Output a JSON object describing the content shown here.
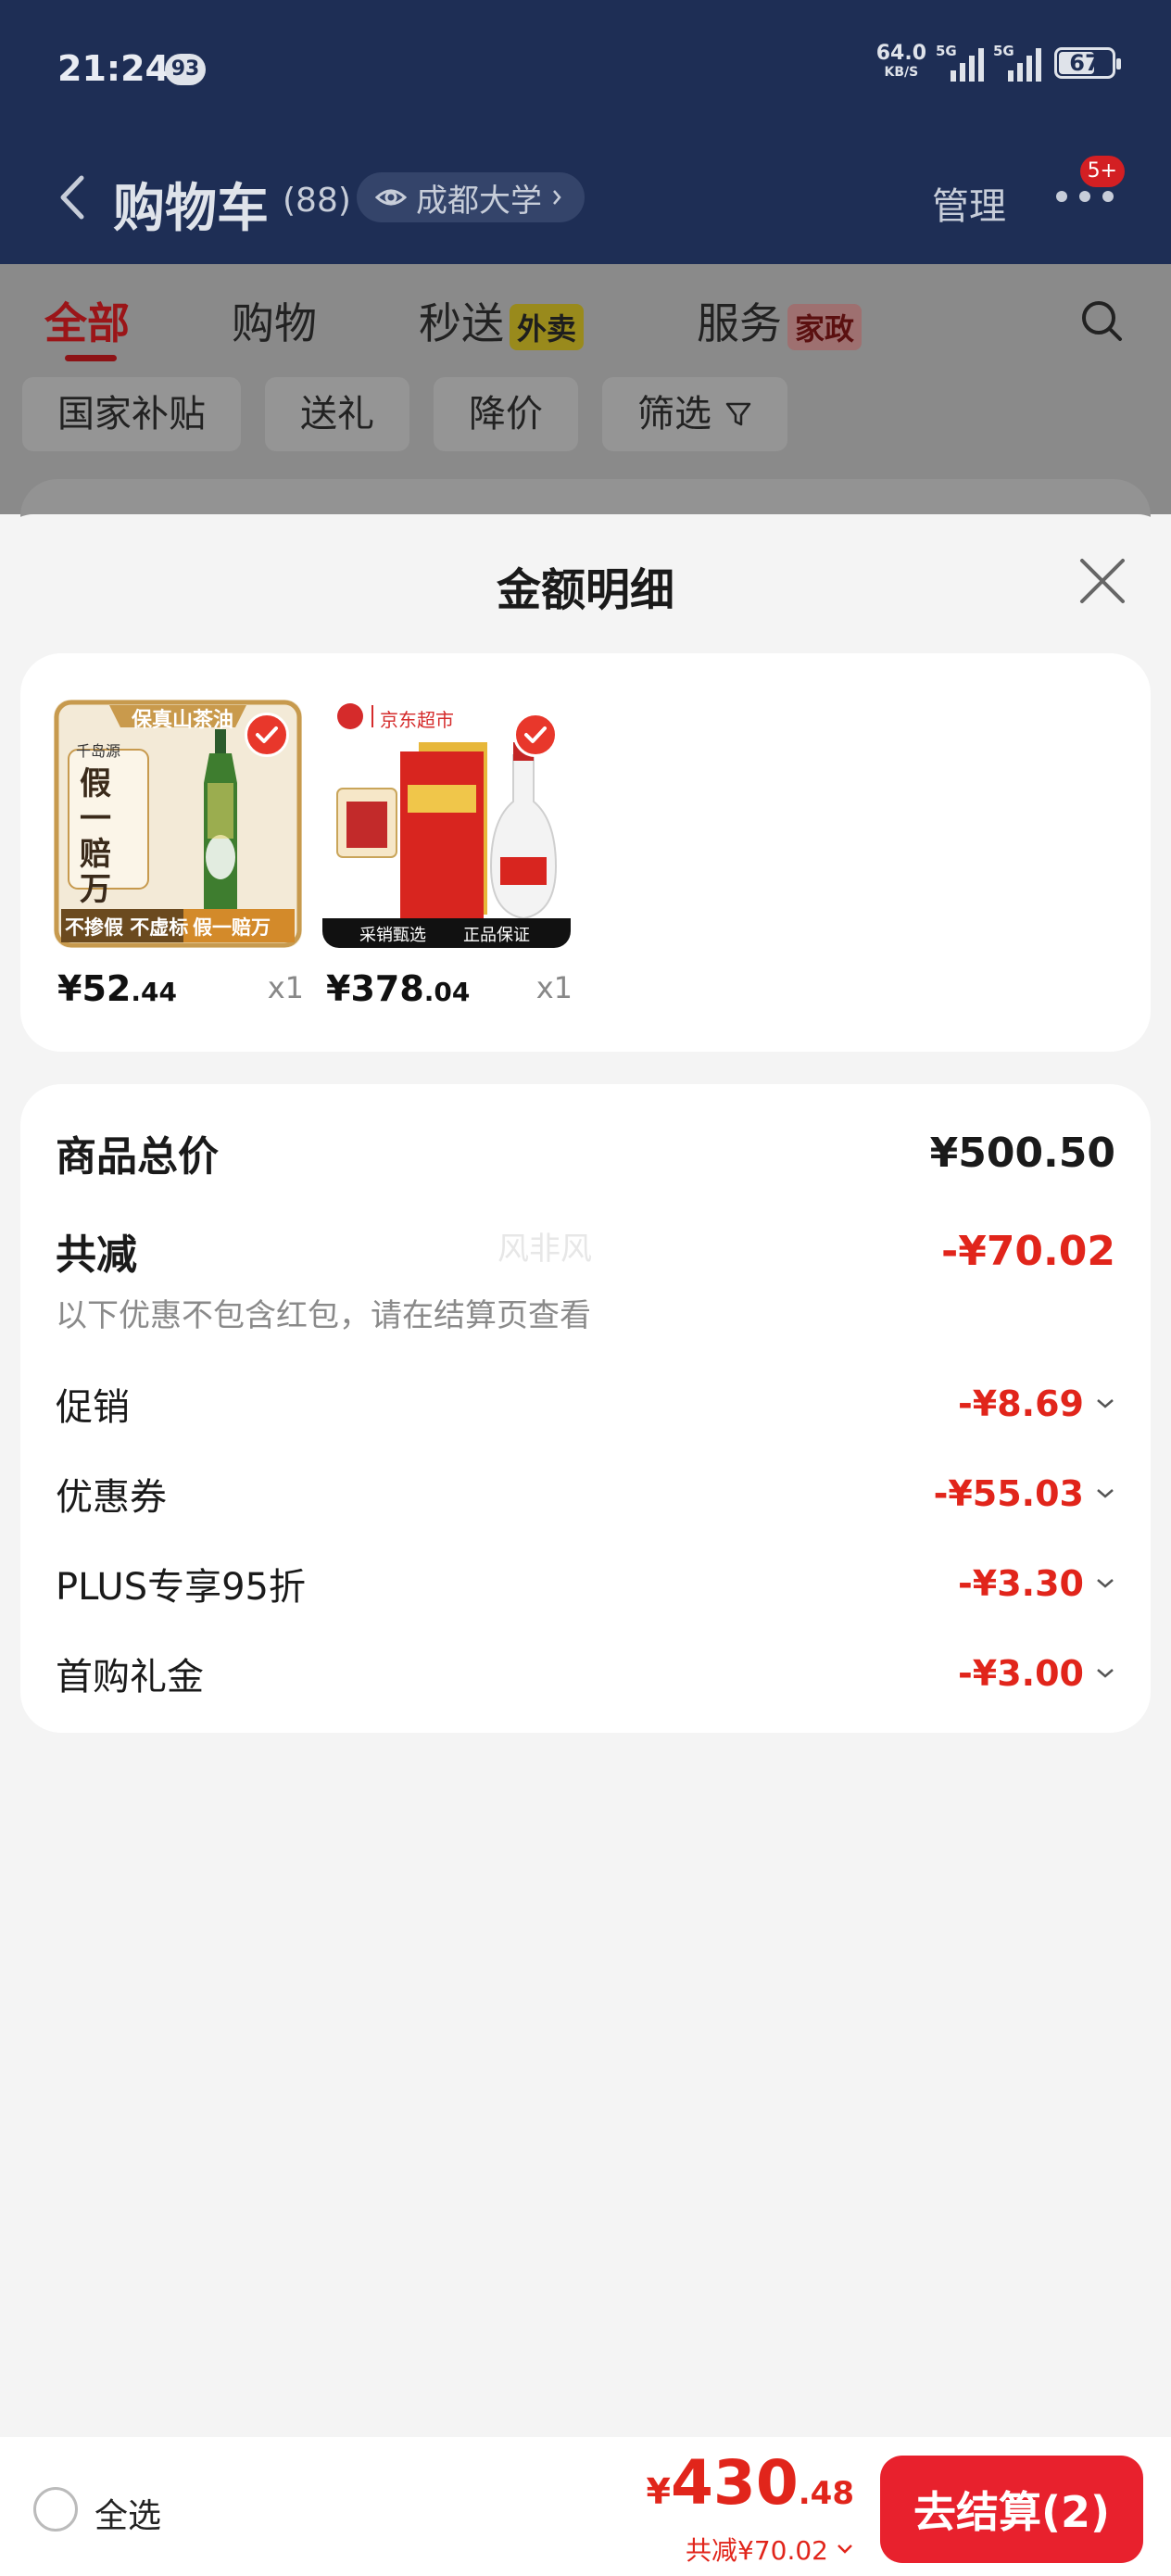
{
  "status_bar": {
    "time": "21:24",
    "notification_count": "93",
    "net_speed": "64.0",
    "net_unit": "KB/S",
    "signal1_label": "5G",
    "signal2_label": "5G",
    "battery": "67"
  },
  "header": {
    "title": "购物车",
    "count": "(88)",
    "location": "成都大学",
    "manage": "管理",
    "more_badge": "5+"
  },
  "tabs": [
    {
      "label": "全部",
      "active": true
    },
    {
      "label": "购物"
    },
    {
      "label": "秒送",
      "tag": "外卖"
    },
    {
      "label": "服务",
      "tag": "家政"
    }
  ],
  "filters": [
    "国家补贴",
    "送礼",
    "降价",
    "筛选"
  ],
  "sheet": {
    "title": "金额明细",
    "products": [
      {
        "banner": "保真山茶油",
        "brand": "千岛源",
        "badge_text": "假一赔万",
        "footer_left": "不掺假 不虚标",
        "footer_right": "假一赔万",
        "price_int": "¥52",
        "price_dec": ".44",
        "qty": "x1"
      },
      {
        "banner": "京东超市",
        "footer_left": "采销甄选",
        "footer_right": "正品保证",
        "price_int": "¥378",
        "price_dec": ".04",
        "qty": "x1"
      }
    ],
    "summary": {
      "total_label": "商品总价",
      "total_value": "¥500.50",
      "reduce_label": "共减",
      "reduce_value": "-¥70.02",
      "note": "以下优惠不包含红包，请在结算页查看",
      "watermark": "风非风",
      "items": [
        {
          "label": "促销",
          "value": "-¥8.69"
        },
        {
          "label": "优惠券",
          "value": "-¥55.03"
        },
        {
          "label": "PLUS专享95折",
          "value": "-¥3.30"
        },
        {
          "label": "首购礼金",
          "value": "-¥3.00"
        }
      ]
    }
  },
  "bottom_bar": {
    "select_all": "全选",
    "currency": "¥",
    "total_int": "430",
    "total_dec": ".48",
    "saved": "共减¥70.02",
    "checkout": "去结算(2)"
  },
  "colors": {
    "accent_red": "#e1251b",
    "header_bg": "#1e2e55"
  }
}
